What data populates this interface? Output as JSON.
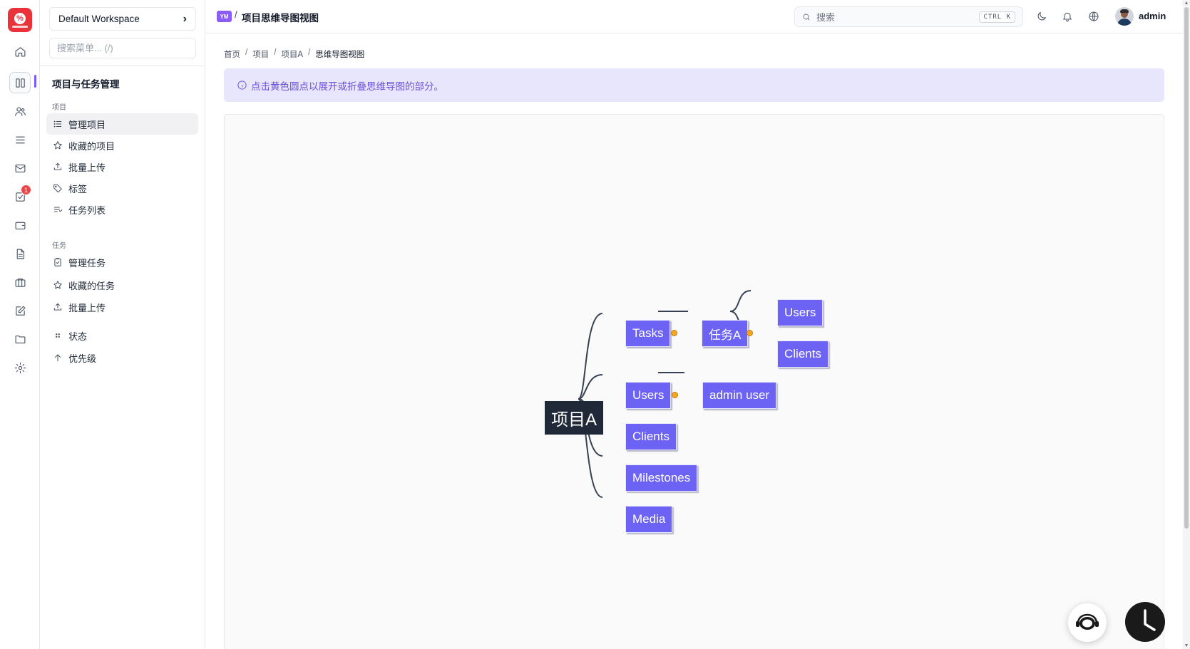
{
  "rail": {
    "logo_icon": "app-logo",
    "items": [
      {
        "name": "home-icon"
      },
      {
        "name": "board-icon"
      },
      {
        "name": "users-icon"
      },
      {
        "name": "list-icon"
      },
      {
        "name": "mail-icon"
      },
      {
        "name": "tasks-icon"
      },
      {
        "name": "wallet-icon"
      },
      {
        "name": "document-icon"
      },
      {
        "name": "briefcase-icon"
      },
      {
        "name": "edit-icon"
      },
      {
        "name": "folder-icon"
      },
      {
        "name": "settings-icon"
      }
    ],
    "badge_count": "1",
    "accent_color": "#7c5cf5"
  },
  "sidebar": {
    "workspace": "Default Workspace",
    "search_placeholder": "搜索菜单... (/)",
    "title": "项目与任务管理",
    "groups": {
      "projects": "项目",
      "tasks": "任务"
    },
    "items": [
      {
        "label": "管理项目",
        "icon": "list-icon",
        "active": true
      },
      {
        "label": "收藏的项目",
        "icon": "star-icon"
      },
      {
        "label": "批量上传",
        "icon": "upload-icon"
      },
      {
        "label": "标签",
        "icon": "tag-icon"
      },
      {
        "label": "任务列表",
        "icon": "task-list-icon"
      },
      {
        "label": "管理任务",
        "icon": "clipboard-icon"
      },
      {
        "label": "收藏的任务",
        "icon": "star-icon"
      },
      {
        "label": "批量上传",
        "icon": "upload-icon"
      },
      {
        "label": "状态",
        "icon": "grip-icon"
      },
      {
        "label": "优先级",
        "icon": "arrow-up-icon"
      }
    ]
  },
  "header": {
    "project_badge": "YM",
    "separator": "/",
    "title": "项目思维导图视图",
    "search_placeholder": "搜索",
    "shortcut": "CTRL K",
    "user_name": "admin"
  },
  "breadcrumb": [
    "首页",
    "项目",
    "项目A",
    "思维导图视图"
  ],
  "alert": {
    "text": "点击黄色圆点以展开或折叠思维导图的部分。",
    "color": "#6d4fd8",
    "background": "#e8e6fd"
  },
  "mindmap": {
    "root": "项目A",
    "branches": [
      {
        "label": "Tasks",
        "children": [
          {
            "label": "任务A",
            "children": [
              {
                "label": "Users"
              },
              {
                "label": "Clients"
              }
            ]
          }
        ]
      },
      {
        "label": "Users",
        "children": [
          {
            "label": "admin user"
          }
        ]
      },
      {
        "label": "Clients"
      },
      {
        "label": "Milestones"
      },
      {
        "label": "Media"
      }
    ],
    "node_color": "#6c63f5",
    "root_color": "#1f2937",
    "toggle_color": "#f5a623"
  }
}
